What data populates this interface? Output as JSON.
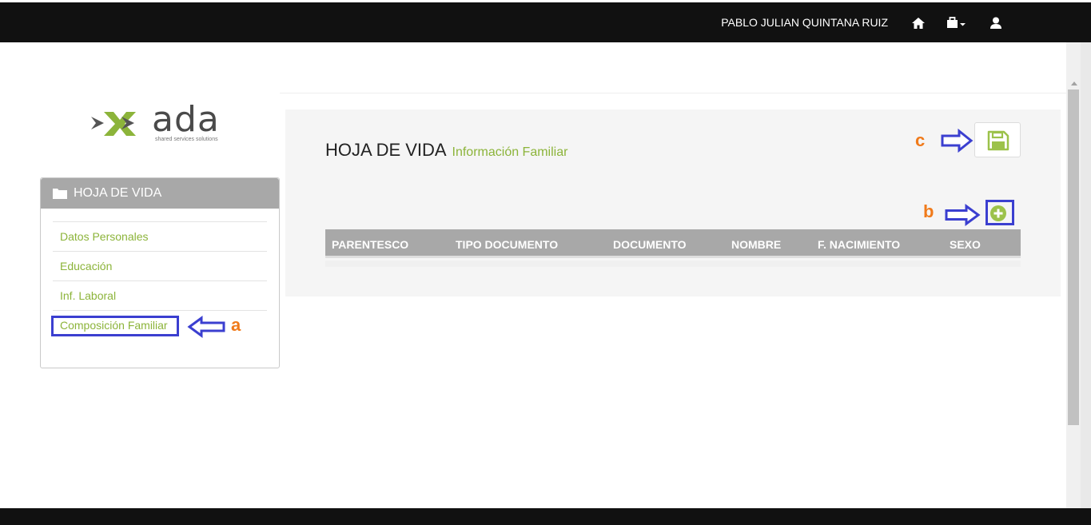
{
  "header": {
    "user_name": "PABLO JULIAN QUINTANA RUIZ",
    "icons": [
      "home-icon",
      "briefcase-icon",
      "user-icon"
    ]
  },
  "logo": {
    "text": "ada",
    "tagline": "shared services solutions"
  },
  "sidebar": {
    "title": "HOJA DE VIDA",
    "items": [
      {
        "label": "Datos Personales"
      },
      {
        "label": "Educación"
      },
      {
        "label": "Inf. Laboral"
      },
      {
        "label": "Composición Familiar"
      }
    ]
  },
  "main": {
    "title": "HOJA DE VIDA",
    "subtitle": "Información Familiar",
    "table": {
      "columns": [
        "PARENTESCO",
        "TIPO DOCUMENTO",
        "DOCUMENTO",
        "NOMBRE",
        "F. NACIMIENTO",
        "SEXO"
      ],
      "rows": []
    }
  },
  "annotations": {
    "a": "a",
    "b": "b",
    "c": "c"
  },
  "colors": {
    "accent_green": "#8cb43a",
    "highlight_blue": "#3b3fd0",
    "annotation_orange": "#f07a1a",
    "header_gray": "#a8a8a8"
  }
}
